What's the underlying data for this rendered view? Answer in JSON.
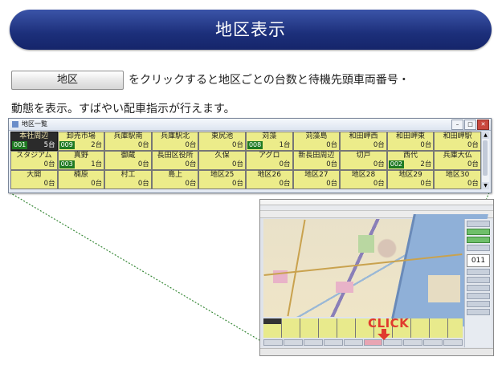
{
  "banner": {
    "title": "地区表示"
  },
  "intro": {
    "button_label": "地区",
    "line1": "をクリックすると地区ごとの台数と待機先頭車両番号・",
    "line2": "動態を表示。すばやい配車指示が行えます。"
  },
  "window": {
    "title": "地区一覧",
    "cells": [
      {
        "name": "本社周辺",
        "code": "001",
        "count": "5台",
        "selected": true
      },
      {
        "name": "卸売市場",
        "code": "009",
        "count": "2台"
      },
      {
        "name": "兵庫駅南",
        "code": "",
        "count": "0台"
      },
      {
        "name": "兵庫駅北",
        "code": "",
        "count": "0台"
      },
      {
        "name": "東尻池",
        "code": "",
        "count": "0台"
      },
      {
        "name": "苅藻",
        "code": "008",
        "count": "1台"
      },
      {
        "name": "苅藻島",
        "code": "",
        "count": "0台"
      },
      {
        "name": "和田岬西",
        "code": "",
        "count": "0台"
      },
      {
        "name": "和田岬東",
        "code": "",
        "count": "0台"
      },
      {
        "name": "和田岬駅",
        "code": "",
        "count": "0台"
      },
      {
        "name": "スタジアム",
        "code": "",
        "count": "0台"
      },
      {
        "name": "真野",
        "code": "003",
        "count": "1台"
      },
      {
        "name": "御蔵",
        "code": "",
        "count": "0台"
      },
      {
        "name": "長田区役所",
        "code": "",
        "count": "0台"
      },
      {
        "name": "久保",
        "code": "",
        "count": "0台"
      },
      {
        "name": "アグロ",
        "code": "",
        "count": "0台"
      },
      {
        "name": "新長田周辺",
        "code": "",
        "count": "0台"
      },
      {
        "name": "切戸",
        "code": "",
        "count": "0台"
      },
      {
        "name": "西代",
        "code": "002",
        "count": "2台"
      },
      {
        "name": "兵庫大仏",
        "code": "",
        "count": "0台"
      },
      {
        "name": "大開",
        "code": "",
        "count": "0台"
      },
      {
        "name": "楠原",
        "code": "",
        "count": "0台"
      },
      {
        "name": "村工",
        "code": "",
        "count": "0台"
      },
      {
        "name": "島上",
        "code": "",
        "count": "0台"
      },
      {
        "name": "地区25",
        "code": "",
        "count": "0台"
      },
      {
        "name": "地区26",
        "code": "",
        "count": "0台"
      },
      {
        "name": "地区27",
        "code": "",
        "count": "0台"
      },
      {
        "name": "地区28",
        "code": "",
        "count": "0台"
      },
      {
        "name": "地区29",
        "code": "",
        "count": "0台"
      },
      {
        "name": "地区30",
        "code": "",
        "count": "0台"
      }
    ]
  },
  "mini": {
    "readout": "011"
  },
  "click_label": "CLICK",
  "colors": {
    "banner": "#1c2f7a",
    "cell": "#ecec8a",
    "code_bg": "#1f7a22",
    "click": "#e03b2e"
  }
}
